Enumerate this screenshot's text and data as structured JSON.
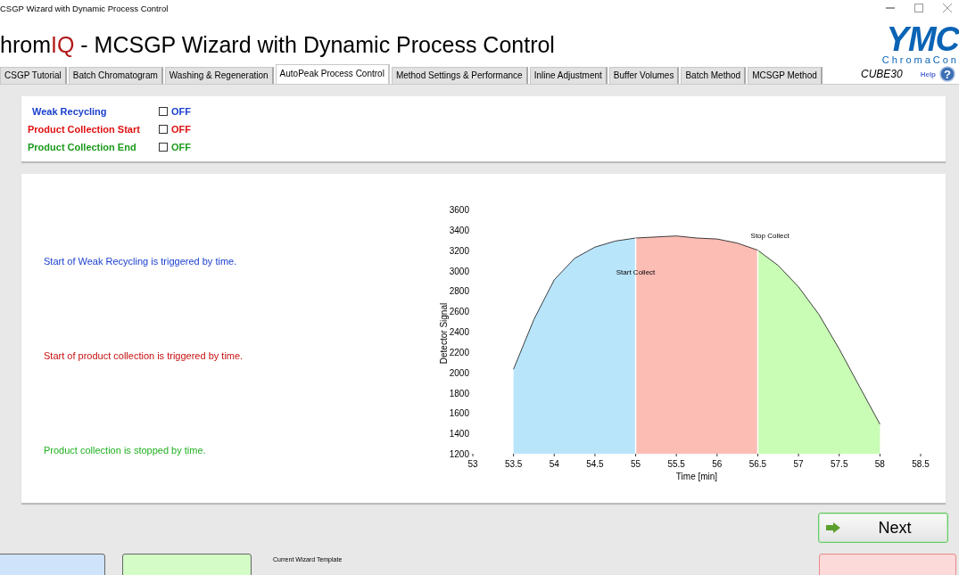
{
  "window": {
    "title": "CSGP Wizard with Dynamic Process Control"
  },
  "header": {
    "brand_prefix": "hrom",
    "brand_suffix": "IQ",
    "title": " - MCSGP Wizard with Dynamic Process Control",
    "logo": "YMC",
    "logo_sub": "ChromaCon"
  },
  "tabs": [
    {
      "label": "CSGP Tutorial",
      "selected": false
    },
    {
      "label": "Batch Chromatogram",
      "selected": false
    },
    {
      "label": "Washing & Regeneration",
      "selected": false
    },
    {
      "label": "AutoPeak Process Control",
      "selected": true
    },
    {
      "label": "Method Settings & Performance",
      "selected": false
    },
    {
      "label": "Inline Adjustment",
      "selected": false
    },
    {
      "label": "Buffer Volumes",
      "selected": false
    },
    {
      "label": "Batch Method",
      "selected": false
    },
    {
      "label": "MCSGP Method",
      "selected": false
    }
  ],
  "device": "CUBE30",
  "help": {
    "label": "Help",
    "icon": "?"
  },
  "switches": [
    {
      "label": "Weak Recycling",
      "checked": false,
      "state": "OFF",
      "color": "#1a3fcf"
    },
    {
      "label": "Product Collection Start",
      "checked": false,
      "state": "OFF",
      "color": "#e01010"
    },
    {
      "label": "Product Collection End",
      "checked": false,
      "state": "OFF",
      "color": "#1a9a1a"
    }
  ],
  "messages": [
    {
      "text": "Start of Weak Recycling is triggered by time.",
      "color": "#1a3fcf"
    },
    {
      "text": "Start of product collection is triggered by time.",
      "color": "#c81010"
    },
    {
      "text": "Product collection is stopped by time.",
      "color": "#20b020"
    }
  ],
  "chart_data": {
    "type": "area",
    "xlabel": "Time [min]",
    "ylabel": "Detector Signal",
    "x": [
      53.5,
      53.75,
      54,
      54.25,
      54.5,
      54.75,
      55,
      55.25,
      55.5,
      55.75,
      56,
      56.25,
      56.5,
      56.75,
      57,
      57.25,
      57.5,
      57.75,
      58
    ],
    "series": [
      {
        "color": "#b9e5fb",
        "values": [
          2030,
          2520,
          2910,
          3120,
          3230,
          3290,
          3320,
          null,
          null,
          null,
          null,
          null,
          null,
          null,
          null,
          null,
          null,
          null,
          null
        ]
      },
      {
        "color": "#fcbdb5",
        "values": [
          null,
          null,
          null,
          null,
          null,
          null,
          3320,
          3330,
          3340,
          3320,
          3310,
          3270,
          3200,
          null,
          null,
          null,
          null,
          null,
          null
        ]
      },
      {
        "color": "#c9fcb5",
        "values": [
          null,
          null,
          null,
          null,
          null,
          null,
          null,
          null,
          null,
          null,
          null,
          null,
          3200,
          3050,
          2840,
          2570,
          2230,
          1860,
          1490
        ]
      }
    ],
    "xlim": [
      53,
      58.5
    ],
    "ylim": [
      1200,
      3600
    ],
    "xticks": [
      53,
      53.5,
      54,
      54.5,
      55,
      55.5,
      56,
      56.5,
      57,
      57.5,
      58,
      58.5
    ],
    "yticks": [
      1200,
      1400,
      1600,
      1800,
      2000,
      2200,
      2400,
      2600,
      2800,
      3000,
      3200,
      3400,
      3600
    ],
    "annotations": [
      "Start Collect",
      "Stop Collect"
    ]
  },
  "next_button": "Next",
  "template_label": "Current Wizard Template",
  "footer_buttons": [
    {
      "color": "#cfe3fb"
    },
    {
      "color": "#d3fcc6"
    },
    {
      "color": "#fcdada"
    }
  ]
}
